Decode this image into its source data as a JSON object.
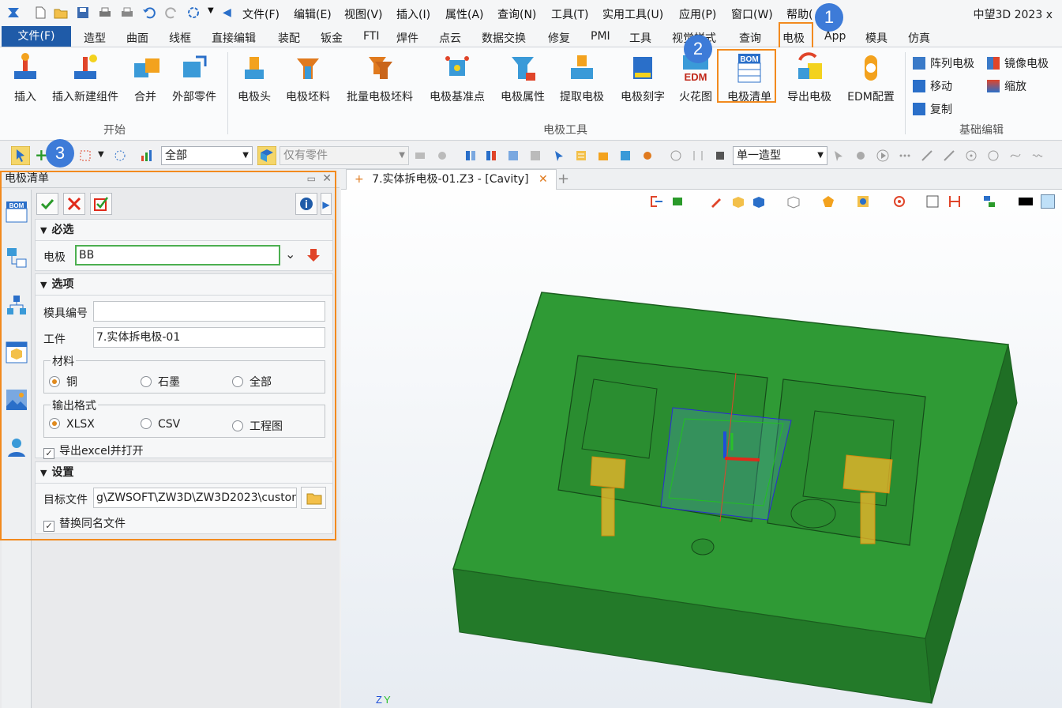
{
  "app": {
    "title": "中望3D 2023 x"
  },
  "menus": [
    "文件(F)",
    "编辑(E)",
    "视图(V)",
    "插入(I)",
    "属性(A)",
    "查询(N)",
    "工具(T)",
    "实用工具(U)",
    "应用(P)",
    "窗口(W)",
    "帮助("
  ],
  "ribbon_tabs": {
    "file": "文件(F)",
    "items": [
      "造型",
      "曲面",
      "线框",
      "直接编辑",
      "装配",
      "钣金",
      "FTI",
      "焊件",
      "点云",
      "数据交换",
      "修复",
      "PMI",
      "工具",
      "视觉样式",
      "查询",
      "电极",
      "App",
      "模具",
      "仿真"
    ],
    "active": "电极"
  },
  "badges": [
    "1",
    "2",
    "3"
  ],
  "ribbon": {
    "start_buttons": [
      "插入",
      "插入新建组件",
      "合并",
      "外部零件"
    ],
    "start_group": "开始",
    "tools_buttons": [
      "电极头",
      "电极坯料",
      "批量电极坯料",
      "电极基准点",
      "电极属性",
      "提取电极",
      "电极刻字",
      "火花图",
      "电极清单",
      "导出电极",
      "EDM配置"
    ],
    "tools_group": "电极工具",
    "edit_buttons": [
      "阵列电极",
      "镜像电极",
      "移动",
      "缩放",
      "复制"
    ],
    "edit_group": "基础编辑",
    "icon_texts": {
      "bom": "BOM",
      "edm": "EDM"
    }
  },
  "toolbar2": {
    "filter_all": "全部",
    "parts_only": "仅有零件",
    "single_shape": "单一造型"
  },
  "panel": {
    "title": "电极清单",
    "section_required": "必选",
    "electrode_label": "电极",
    "electrode_value": "BB",
    "section_options": "选项",
    "mold_no_label": "模具编号",
    "mold_no_value": "",
    "workpiece_label": "工件",
    "workpiece_value": "7.实体拆电极-01",
    "material_legend": "材料",
    "materials": [
      "铜",
      "石墨",
      "全部"
    ],
    "material_selected": "铜",
    "format_legend": "输出格式",
    "formats": [
      "XLSX",
      "CSV",
      "工程图"
    ],
    "format_selected": "XLSX",
    "export_open_label": "导出excel并打开",
    "section_settings": "设置",
    "target_label": "目标文件",
    "target_value": "g\\ZWSOFT\\ZW3D\\ZW3D2023\\custom",
    "replace_label": "替换同名文件",
    "sidebar_bom": "BOM"
  },
  "viewport": {
    "tab_label": "7.实体拆电极-01.Z3 - [Cavity]"
  },
  "colors": {
    "accent": "#f28a1e",
    "file_tab": "#1f5ba8",
    "badge": "#3d7bd8",
    "mold": "#2f9a35",
    "electrode": "#f5b82a"
  }
}
